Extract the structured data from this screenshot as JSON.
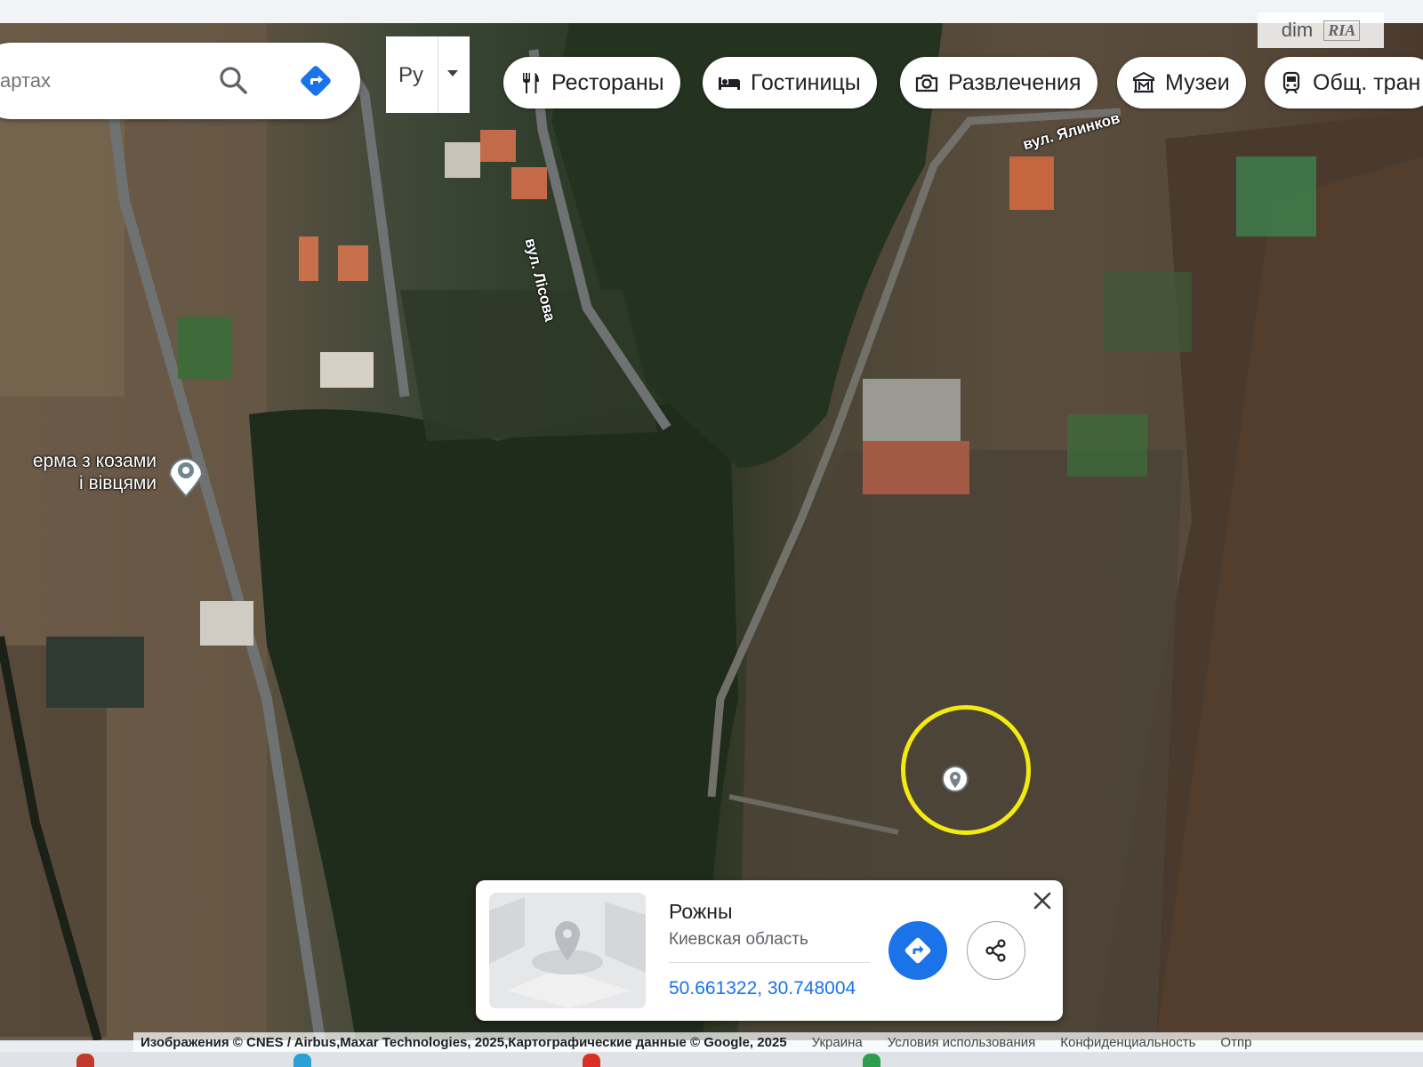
{
  "search": {
    "placeholder": "артах"
  },
  "language": {
    "label": "Ру"
  },
  "chips": [
    {
      "label": "Рестораны",
      "icon": "fork-knife-icon"
    },
    {
      "label": "Гостиницы",
      "icon": "bed-icon"
    },
    {
      "label": "Развлечения",
      "icon": "camera-icon"
    },
    {
      "label": "Музеи",
      "icon": "museum-icon"
    },
    {
      "label": "Общ. тран",
      "icon": "transit-icon"
    }
  ],
  "watermark": {
    "left": "dim",
    "right": "RIA"
  },
  "map": {
    "road_labels": [
      "вул. Лісова",
      "вул. Ялинков"
    ],
    "poi": {
      "line1": "ерма з козами",
      "line2": "і вівцями",
      "icon": "place-pin-icon"
    },
    "highlight_color": "#f2ea10"
  },
  "place_card": {
    "title": "Рожны",
    "subtitle": "Киевская область",
    "coordinates": "50.661322, 30.748004",
    "accent_color": "#1a73e8"
  },
  "footer": {
    "copyright": "Изображения © CNES / Airbus,Maxar Technologies, 2025,Картографические данные © Google, 2025",
    "links": [
      "Украина",
      "Условия использования",
      "Конфиденциальность",
      "Отпр"
    ]
  }
}
